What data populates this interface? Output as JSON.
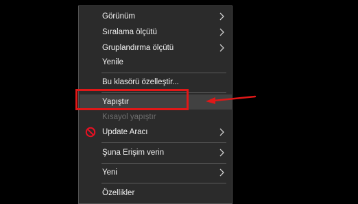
{
  "context_menu": {
    "items": [
      {
        "label": "Görünüm"
      },
      {
        "label": "Sıralama ölçütü"
      },
      {
        "label": "Gruplandırma ölçütü"
      },
      {
        "label": "Yenile"
      },
      {
        "label": "Bu klasörü özelleştir..."
      },
      {
        "label": "Yapıştır"
      },
      {
        "label": "Kısayol yapıştır"
      },
      {
        "label": "Update Aracı"
      },
      {
        "label": "Şuna Erişim verin"
      },
      {
        "label": "Yeni"
      },
      {
        "label": "Özellikler"
      }
    ],
    "highlighted_item": "Yapıştır",
    "disabled_item": "Kısayol yapıştır"
  },
  "annotation": {
    "box_color": "#e01818",
    "arrow_color": "#e01818",
    "target": "Yapıştır"
  },
  "colors": {
    "background": "#000000",
    "menu_background": "#2b2b2b",
    "menu_text": "#f2f2f2",
    "disabled_text": "#6e6e6e",
    "separator": "#5c5c5c",
    "block_icon": "#e81123"
  },
  "icons": {
    "submenu": "chevron-right-icon",
    "update_tool": "block-icon"
  }
}
